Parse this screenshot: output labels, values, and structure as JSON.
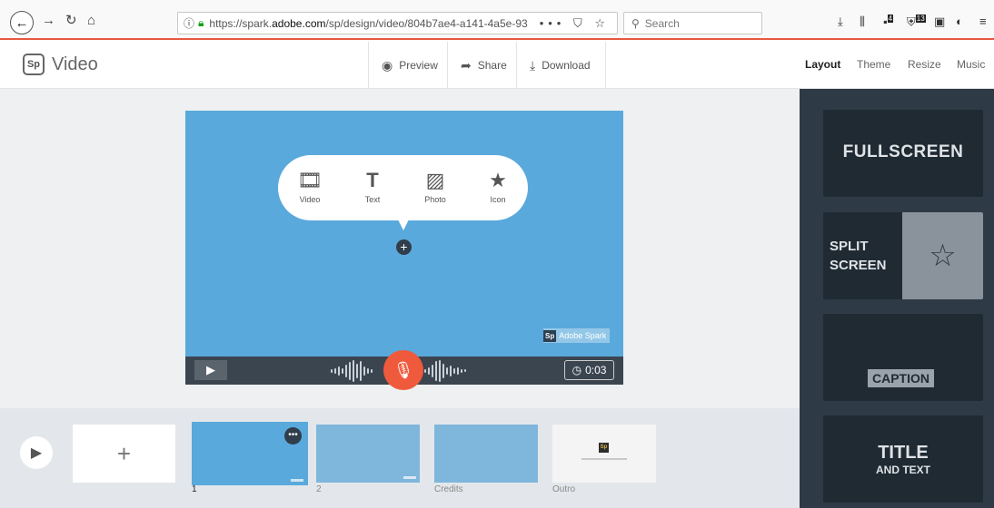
{
  "browser": {
    "url_prefix": "https://spark.",
    "url_domain": "adobe.com",
    "url_path": "/sp/design/video/804b7ae4-a141-4a5e-93",
    "url_actions": "••• ⛉ ☆",
    "search_placeholder": "Search",
    "badge_1": "4",
    "badge_2": "13"
  },
  "app": {
    "logo_mark": "Sp",
    "title": "Video",
    "actions": {
      "preview": "Preview",
      "share": "Share",
      "download": "Download"
    },
    "tabs": {
      "layout": "Layout",
      "theme": "Theme",
      "resize": "Resize",
      "music": "Music"
    },
    "active_tab": "Layout"
  },
  "canvas": {
    "background": "#5aa9dc",
    "options": [
      {
        "label": "Video",
        "icon": "film-icon"
      },
      {
        "label": "Text",
        "icon": "text-icon"
      },
      {
        "label": "Photo",
        "icon": "photo-icon"
      },
      {
        "label": "Icon",
        "icon": "star-icon"
      }
    ],
    "watermark_logo": "Sp",
    "watermark_text": "Adobe Spark",
    "timer": "0:03"
  },
  "timeline": {
    "slides": [
      {
        "label": "1"
      },
      {
        "label": "2"
      },
      {
        "label": "Credits"
      },
      {
        "label": "Outro"
      }
    ],
    "outro_logo": "Sp"
  },
  "layouts": {
    "fullscreen": "FULLSCREEN",
    "split_line1": "SPLIT",
    "split_line2": "SCREEN",
    "caption": "CAPTION",
    "title_main": "TITLE",
    "title_sub": "AND TEXT"
  },
  "colors": {
    "accent": "#f05a3c",
    "panel": "#2e3a45",
    "card": "#1f2a33"
  }
}
